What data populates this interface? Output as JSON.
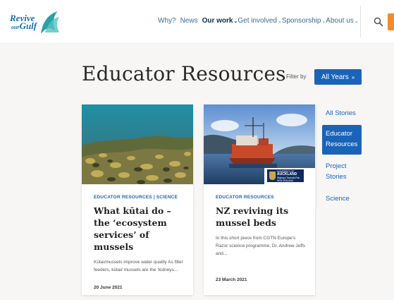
{
  "header": {
    "logo": {
      "line1": "Revive",
      "small": "our",
      "line2": "Gulf"
    },
    "nav": [
      {
        "label": "Why?",
        "has_menu": false,
        "active": false
      },
      {
        "label": "News",
        "has_menu": false,
        "active": false
      },
      {
        "label": "Our work",
        "has_menu": true,
        "active": true
      },
      {
        "label": "Get involved",
        "has_menu": true,
        "active": false
      },
      {
        "label": "Sponsorship",
        "has_menu": true,
        "active": false
      },
      {
        "label": "About us",
        "has_menu": true,
        "active": false
      }
    ],
    "search_icon": "search-icon",
    "accent_color": "#f28c28"
  },
  "page": {
    "title": "Educator Resources",
    "filter_label": "Filter by",
    "years_button": "All Years",
    "primary_color": "#1a63b8"
  },
  "cards": [
    {
      "category": "EDUCATOR RESOURCES | SCIENCE",
      "title": "What kūtai do – the ‘ecosystem services’ of mussels",
      "excerpt": "Kūtai/mussels improve water quality As filter feeders, kūtai/ mussels are the ‘kidneys...",
      "date": "20 June 2021"
    },
    {
      "category": "EDUCATOR RESOURCES",
      "title": "NZ reviving its mussel beds",
      "excerpt": "In this short piece from CGTN Europe's Razor science programme, Dr. Andrew Jeffs and...",
      "date": "23 March 2021",
      "badge": {
        "line1": "UNIVERSITY OF",
        "line2": "AUCKLAND",
        "line3": "Waipapa Taumata Rau",
        "line4": "NEW ZEALAND"
      }
    }
  ],
  "sidebar": {
    "items": [
      {
        "label": "All Stories",
        "active": false
      },
      {
        "label": "Educator Resources",
        "active": true
      },
      {
        "label": "Project Stories",
        "active": false
      },
      {
        "label": "Science",
        "active": false
      }
    ]
  }
}
